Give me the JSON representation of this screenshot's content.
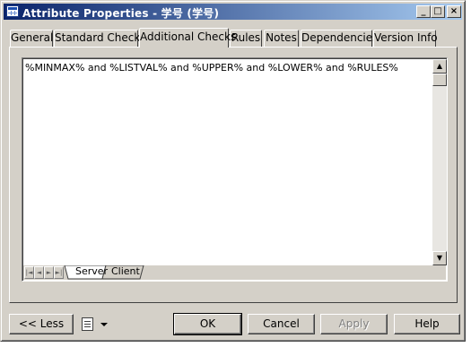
{
  "window": {
    "title": "Attribute Properties - 学号 (学号)",
    "controls": {
      "minimize": "_",
      "maximize": "□",
      "close": "×"
    }
  },
  "tabs": [
    {
      "label": "General"
    },
    {
      "label": "Standard Checks"
    },
    {
      "label": "Additional Checks",
      "active": true
    },
    {
      "label": "Rules"
    },
    {
      "label": "Notes"
    },
    {
      "label": "Dependencies"
    },
    {
      "label": "Version Info"
    }
  ],
  "editor": {
    "text": "%MINMAX% and %LISTVAL% and %UPPER% and %LOWER% and %RULES%",
    "sheet_tabs": [
      {
        "label": "Server",
        "active": true
      },
      {
        "label": "Client"
      }
    ]
  },
  "footer": {
    "less_label": "<< Less",
    "ok_label": "OK",
    "cancel_label": "Cancel",
    "apply_label": "Apply",
    "help_label": "Help"
  }
}
